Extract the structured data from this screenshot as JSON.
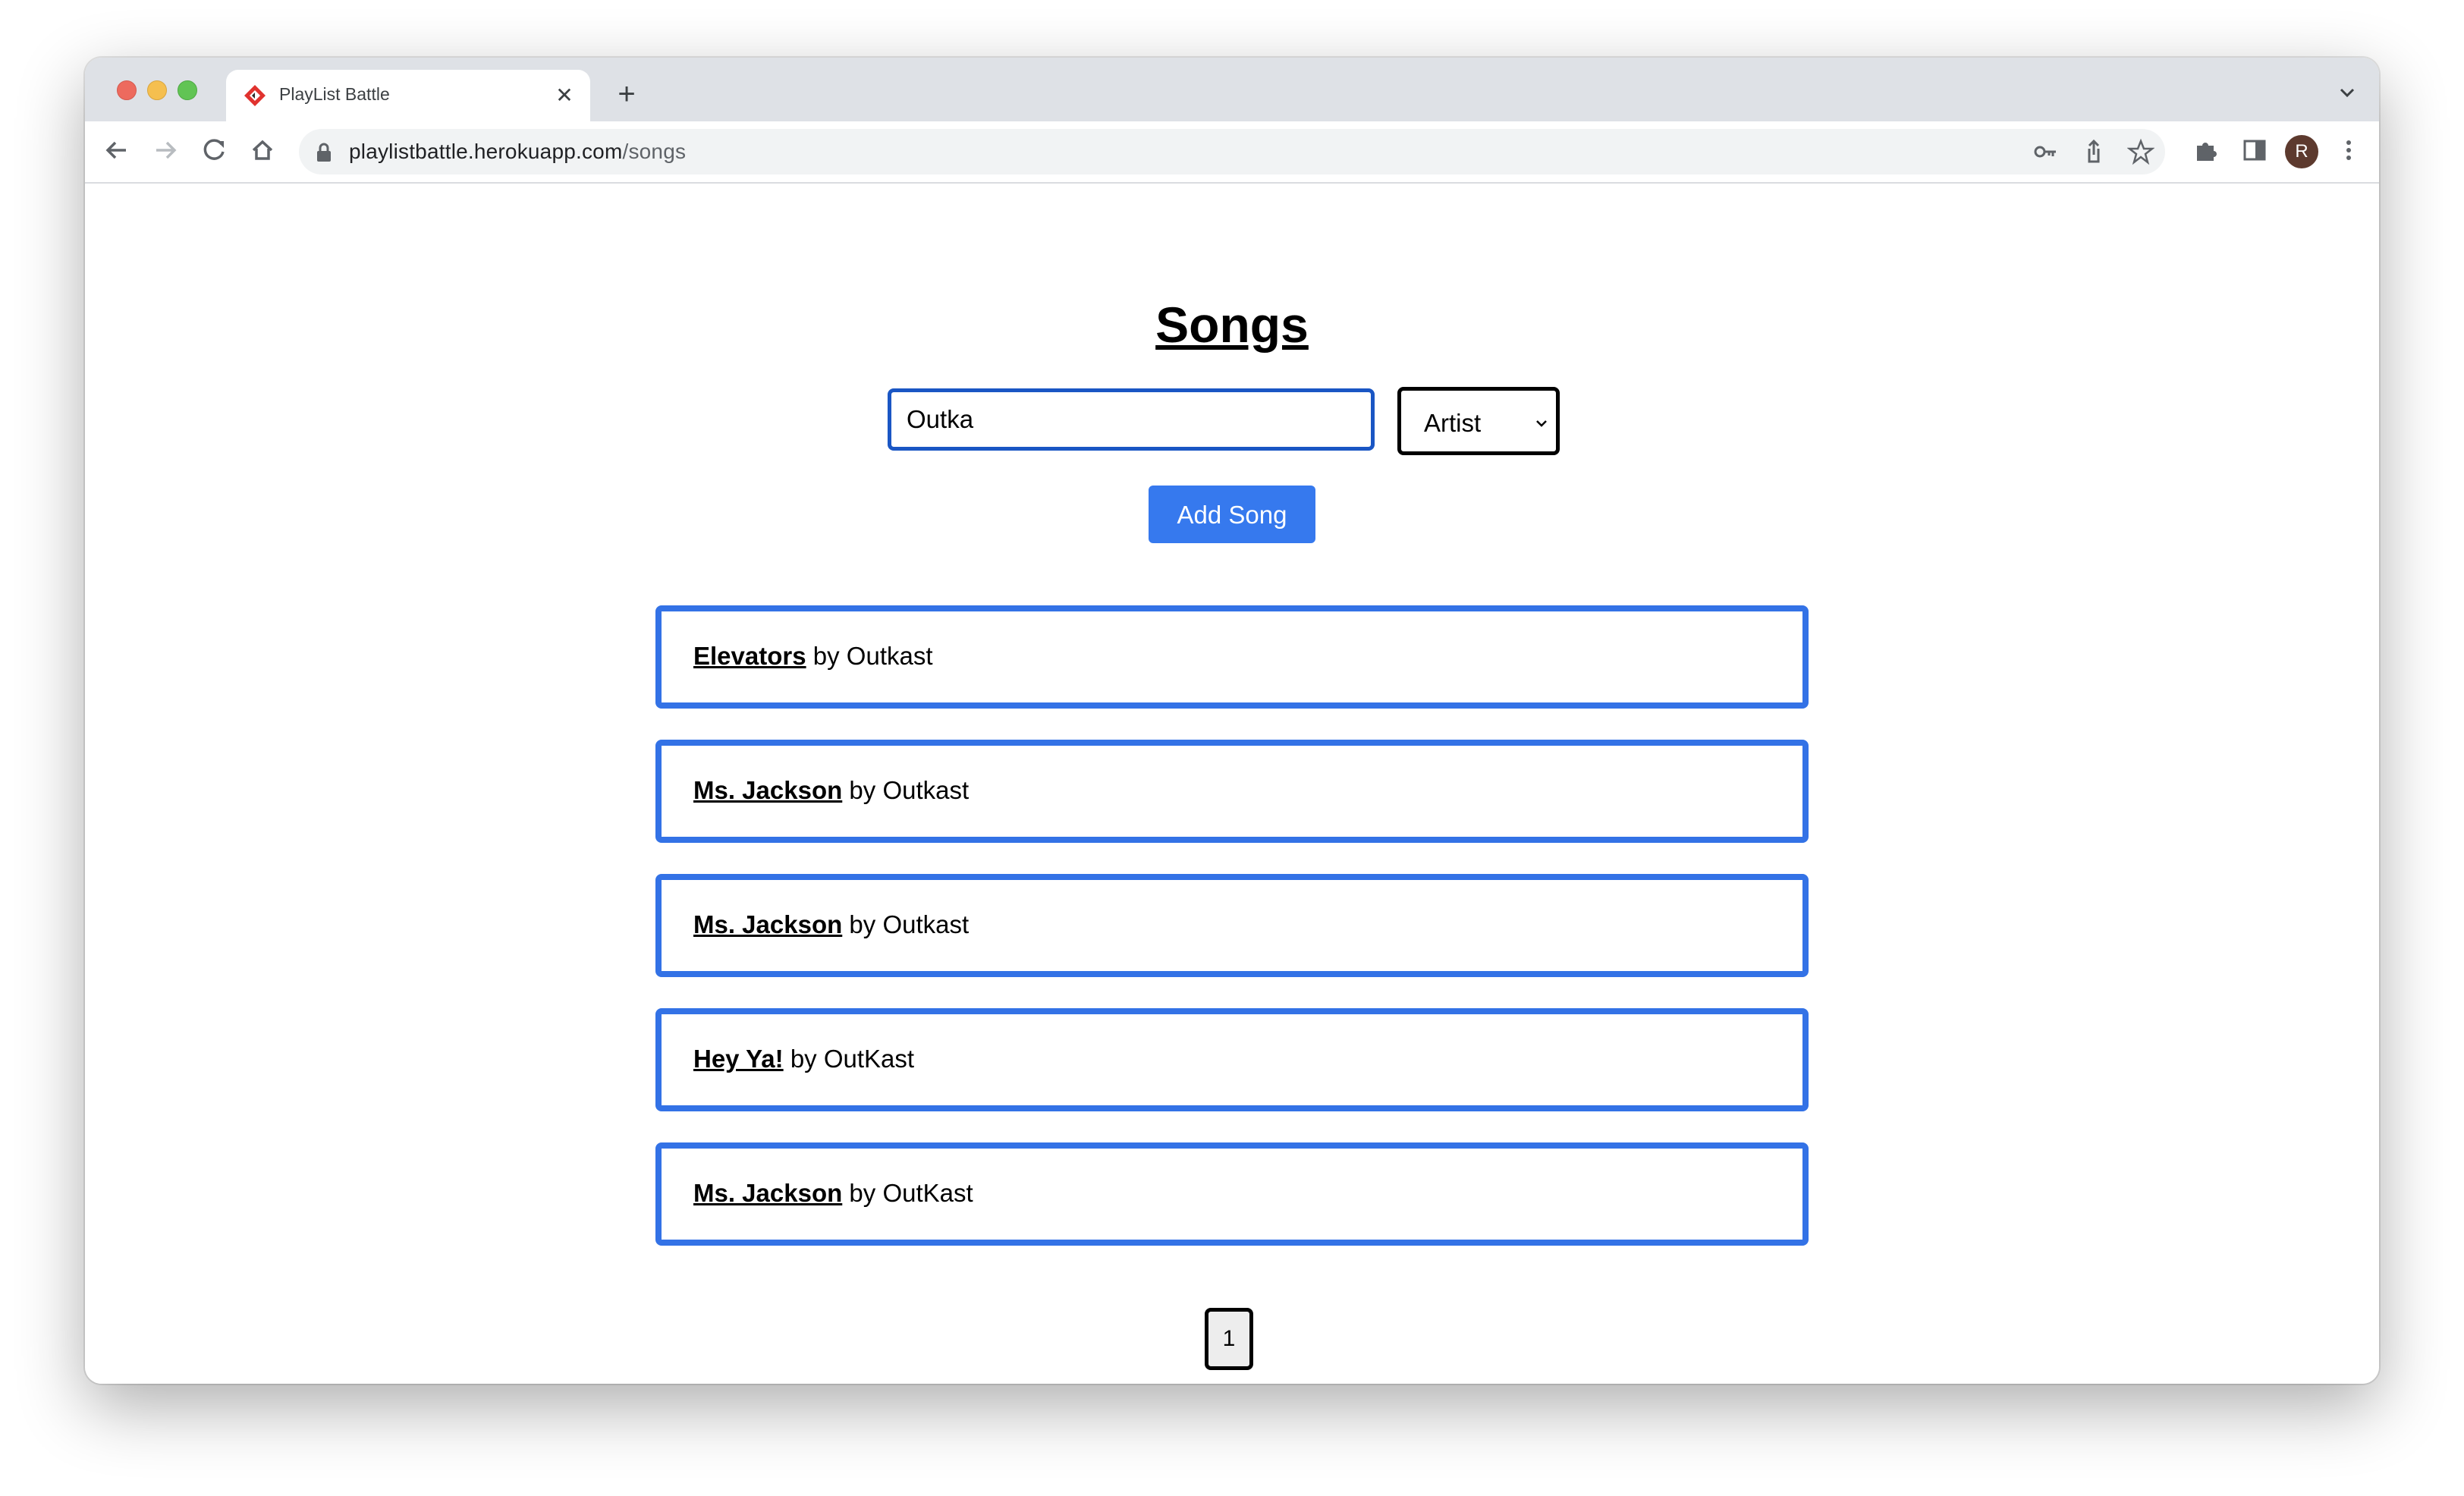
{
  "browser": {
    "tab_title": "PlayList Battle",
    "url_host": "playlistbattle.herokuapp.com",
    "url_path": "/songs",
    "profile_initial": "R"
  },
  "page": {
    "title": "Songs",
    "search_value": "Outka",
    "field_select_value": "Artist",
    "add_button_label": "Add Song",
    "songs": [
      {
        "title": "Elevators",
        "by": " by ",
        "artist": "Outkast"
      },
      {
        "title": "Ms. Jackson",
        "by": " by ",
        "artist": "Outkast"
      },
      {
        "title": "Ms. Jackson",
        "by": " by ",
        "artist": "Outkast"
      },
      {
        "title": "Hey Ya!",
        "by": " by ",
        "artist": "OutKast"
      },
      {
        "title": "Ms. Jackson",
        "by": " by ",
        "artist": "OutKast"
      }
    ],
    "pagination": [
      "1"
    ]
  },
  "colors": {
    "accent_blue": "#3372e6",
    "button_blue": "#3679ee",
    "input_border": "#1a56c4"
  }
}
